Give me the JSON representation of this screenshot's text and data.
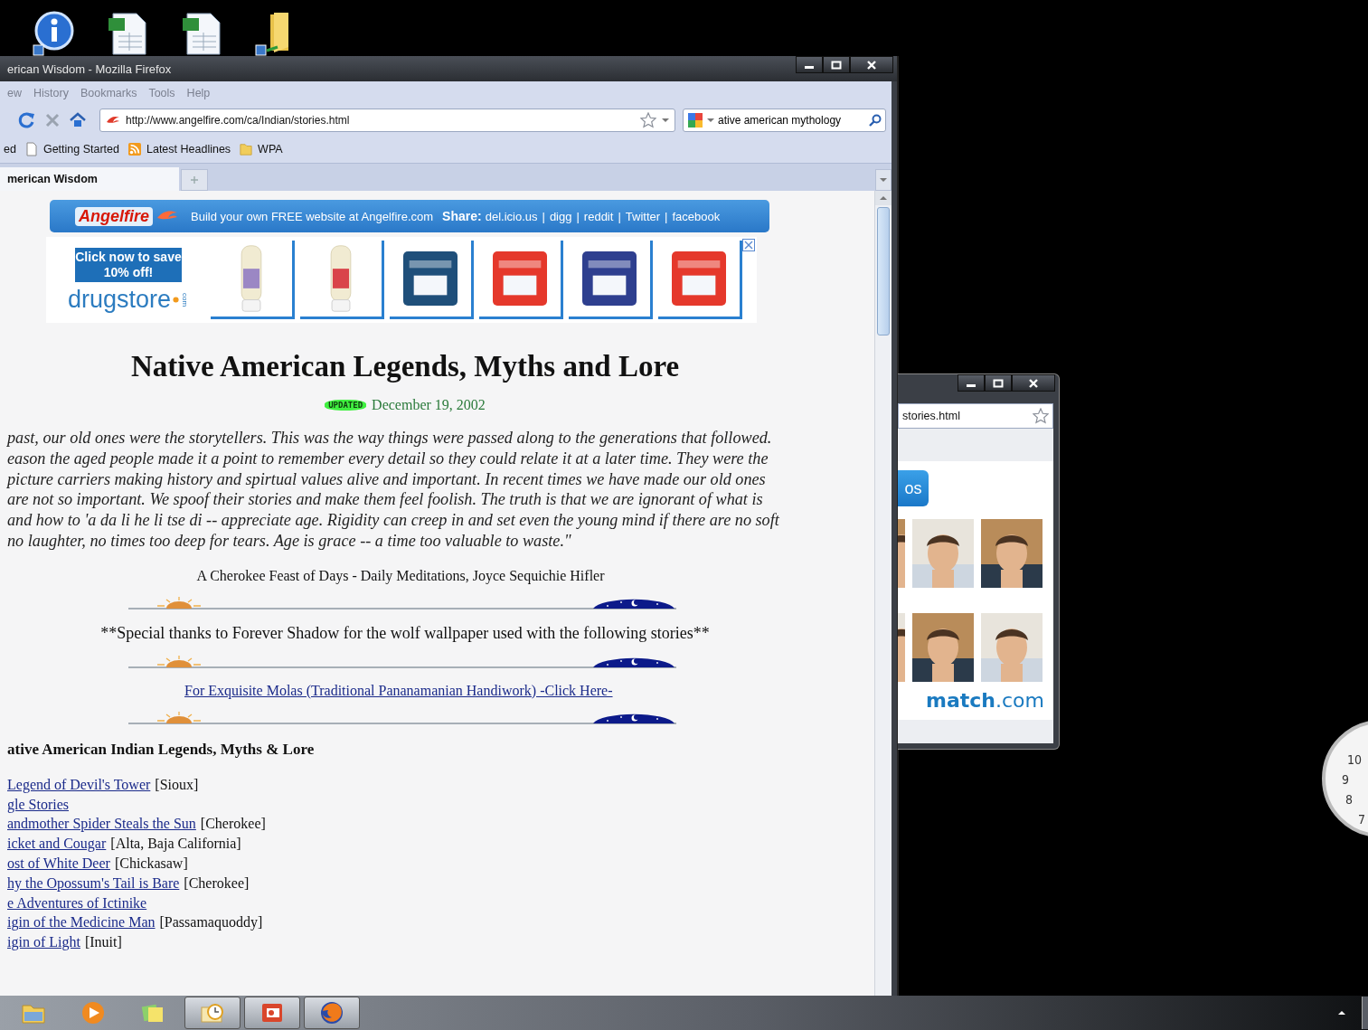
{
  "desktop_icons": [
    {
      "kind": "info"
    },
    {
      "kind": "spreadsheet"
    },
    {
      "kind": "spreadsheet"
    },
    {
      "kind": "folder"
    }
  ],
  "browser": {
    "title": "erican Wisdom - Mozilla Firefox",
    "menu": [
      "ew",
      "History",
      "Bookmarks",
      "Tools",
      "Help"
    ],
    "address": "http://www.angelfire.com/ca/Indian/stories.html",
    "search": "ative american mythology",
    "bookmarks": [
      {
        "label": "ed",
        "kind": "plain"
      },
      {
        "label": "Getting Started",
        "kind": "page"
      },
      {
        "label": "Latest Headlines",
        "kind": "feed"
      },
      {
        "label": "WPA",
        "kind": "folder"
      }
    ],
    "tabs": [
      {
        "label": "merican Wisdom",
        "selected": true
      }
    ]
  },
  "page": {
    "banner": {
      "brand": "Angelfire",
      "text": "Build your own FREE website at Angelfire.com",
      "share_label": "Share:",
      "share_separator": "|",
      "share_links": [
        "del.icio.us",
        "digg",
        "reddit",
        "Twitter",
        "facebook"
      ]
    },
    "ad": {
      "offer": "Click now to save 10% off!",
      "brand": "drugstore",
      "brand_suffix": "com",
      "products": [
        {
          "kind": "bottle",
          "color": "#9b87c4"
        },
        {
          "kind": "bottle",
          "color": "#d9444a"
        },
        {
          "kind": "package",
          "color": "#1f4f7a"
        },
        {
          "kind": "package",
          "color": "#e5382b"
        },
        {
          "kind": "package",
          "color": "#2e3f8f"
        },
        {
          "kind": "package",
          "color": "#e5382b"
        }
      ]
    },
    "title": "Native American Legends, Myths and Lore",
    "updated_badge": "UPDATED",
    "date": "December 19, 2002",
    "quote_lines": [
      "past, our old ones were the storytellers. This was the way things were passed along to the generations that followed.",
      "eason the aged people made it a point to remember every detail so they could relate it at a later time. They were the",
      "picture carriers making history and spirtual values alive and important. In recent times we have made our old ones",
      "are not so important. We spoof their stories and make them feel foolish. The truth is that we are ignorant of what is",
      "and how to 'a da li he li tse di -- appreciate age. Rigidity can creep in and set even the young mind if there are no soft",
      "no laughter, no times too deep for tears. Age is grace -- a time too valuable to waste.\""
    ],
    "attribution": "A Cherokee Feast of Days - Daily Meditations, Joyce Sequichie Hifler",
    "thanks": "**Special thanks to Forever Shadow for the wolf wallpaper used with the following stories**",
    "molas_link": "For Exquisite Molas (Traditional Pananamanian Handiwork) -Click Here-",
    "list_heading": "ative American Indian Legends, Myths & Lore",
    "stories": [
      {
        "title": "Legend of Devil's Tower",
        "tribe": "[Sioux]"
      },
      {
        "title": "gle Stories"
      },
      {
        "title": "andmother Spider Steals the Sun",
        "tribe": "[Cherokee]"
      },
      {
        "title": "icket and Cougar",
        "tribe": "[Alta, Baja California]"
      },
      {
        "title": "ost of White Deer",
        "tribe": "[Chickasaw]"
      },
      {
        "title": "hy the Opossum's Tail is Bare",
        "tribe": "[Cherokee]"
      },
      {
        "title": "e Adventures of Ictinike"
      },
      {
        "title": "igin of the Medicine Man",
        "tribe": "[Passamaquoddy]"
      },
      {
        "title": "igin of Light",
        "tribe": "[Inuit]"
      }
    ]
  },
  "second_window": {
    "address": "stories.html",
    "button_text": "os",
    "logo": "match",
    "logo_suffix": ".com"
  },
  "clock": {
    "numbers": [
      "10",
      "9",
      "8",
      "7"
    ]
  },
  "taskbar": {
    "apps": [
      {
        "kind": "folder",
        "running": false
      },
      {
        "kind": "media",
        "running": false
      },
      {
        "kind": "notes",
        "running": false
      },
      {
        "kind": "mail",
        "running": true
      },
      {
        "kind": "slides",
        "running": true
      },
      {
        "kind": "firefox",
        "running": true
      }
    ]
  }
}
